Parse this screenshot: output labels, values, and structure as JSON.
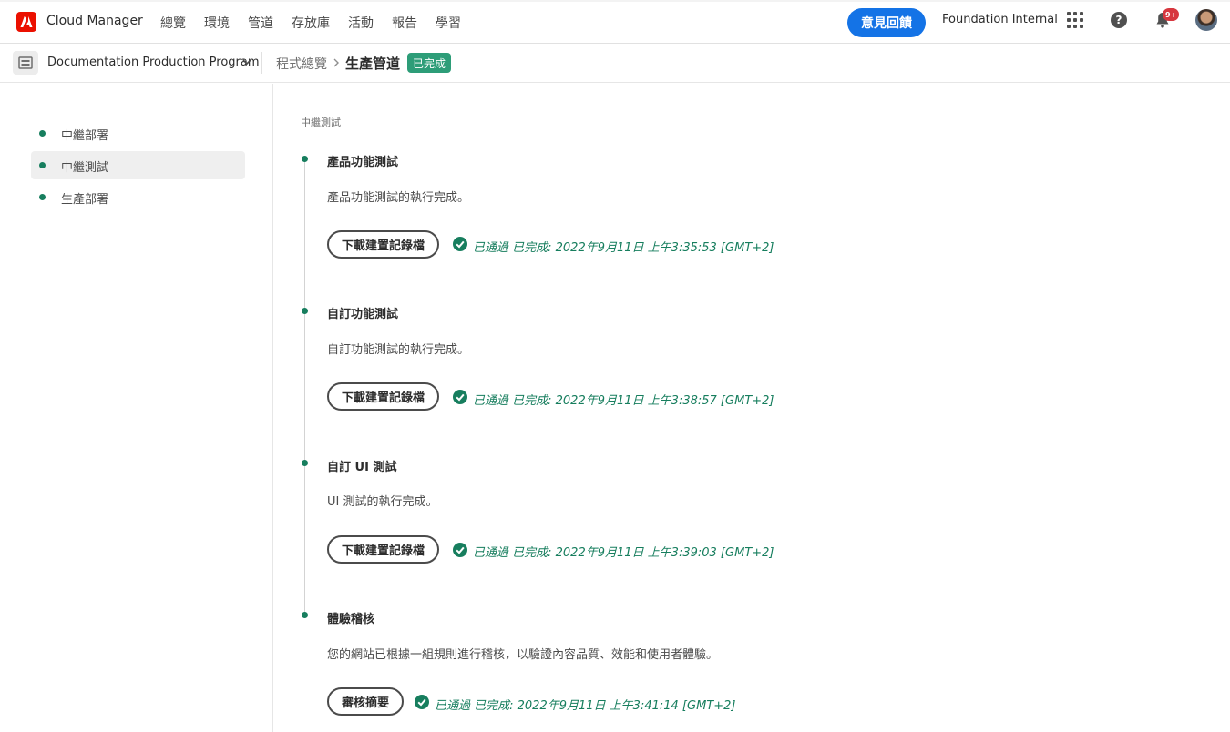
{
  "header": {
    "app_title": "Cloud Manager",
    "nav": [
      "總覽",
      "環境",
      "管道",
      "存放庫",
      "活動",
      "報告",
      "學習"
    ],
    "feedback_label": "意見回饋",
    "org_name": "Foundation Internal",
    "notification_count": "9+",
    "help_glyph": "?",
    "brand_color": "#eb1000",
    "accent_color": "#1473e6"
  },
  "subheader": {
    "program_name": "Documentation Production Program",
    "breadcrumb_link": "程式總覽",
    "breadcrumb_current": "生產管道",
    "status_badge": "已完成",
    "status_color": "#2d9d78"
  },
  "steps": [
    {
      "label": "中繼部署",
      "active": false
    },
    {
      "label": "中繼測試",
      "active": true
    },
    {
      "label": "生產部署",
      "active": false
    }
  ],
  "main": {
    "section_label": "中繼測試",
    "tests": [
      {
        "title": "產品功能測試",
        "description": "產品功能測試的執行完成。",
        "button_label": "下載建置記錄檔",
        "status": "已通過 已完成: 2022年9月11日 上午3:35:53 [GMT+2]"
      },
      {
        "title": "自訂功能測試",
        "description": "自訂功能測試的執行完成。",
        "button_label": "下載建置記錄檔",
        "status": "已通過 已完成: 2022年9月11日 上午3:38:57 [GMT+2]"
      },
      {
        "title": "自訂 UI 測試",
        "description": "UI 測試的執行完成。",
        "button_label": "下載建置記錄檔",
        "status": "已通過 已完成: 2022年9月11日 上午3:39:03 [GMT+2]"
      },
      {
        "title": "體驗稽核",
        "description": "您的網站已根據一組規則進行稽核，以驗證內容品質、效能和使用者體驗。",
        "button_label": "審核摘要",
        "status": "已通過 已完成: 2022年9月11日 上午3:41:14 [GMT+2]"
      }
    ],
    "success_color": "#177e5e",
    "icons": {
      "status": "check-circle-icon",
      "node": "timeline-dot-icon"
    }
  }
}
